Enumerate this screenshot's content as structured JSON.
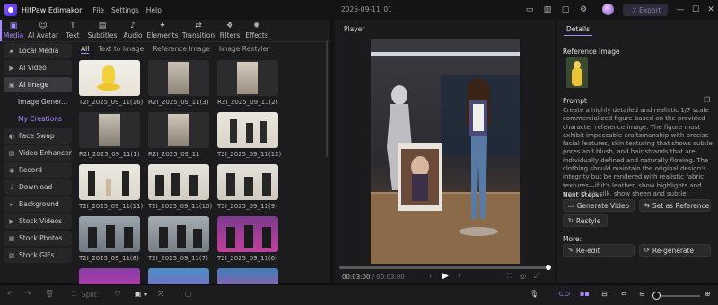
{
  "app": {
    "name": "HitPaw Edimakor",
    "menu": [
      "File",
      "Settings",
      "Help"
    ],
    "document_title": "2025-09-11_01",
    "export_label": "Export"
  },
  "toolbar": {
    "tools": [
      {
        "label": "Media",
        "icon": "media-icon",
        "active": true
      },
      {
        "label": "AI Avatar",
        "icon": "ai-avatar-icon",
        "active": false
      },
      {
        "label": "Text",
        "icon": "text-icon",
        "active": false
      },
      {
        "label": "Subtitles",
        "icon": "subtitles-icon",
        "active": false
      },
      {
        "label": "Audio",
        "icon": "audio-icon",
        "active": false
      },
      {
        "label": "Elements",
        "icon": "elements-icon",
        "active": false
      },
      {
        "label": "Transition",
        "icon": "transition-icon",
        "active": false
      },
      {
        "label": "Filters",
        "icon": "filters-icon",
        "active": false
      },
      {
        "label": "Effects",
        "icon": "effects-icon",
        "active": false
      }
    ]
  },
  "sidebar": {
    "items": [
      {
        "label": "Local Media",
        "icon": "folder-icon"
      },
      {
        "label": "AI Video",
        "icon": "ai-video-icon"
      },
      {
        "label": "AI Image",
        "icon": "ai-image-icon",
        "active": true
      },
      {
        "label": "Image Gener...",
        "sub": true
      },
      {
        "label": "My Creations",
        "sub": true,
        "selected": true
      },
      {
        "label": "Face Swap",
        "icon": "face-swap-icon"
      },
      {
        "label": "Video Enhancer",
        "icon": "enhancer-icon"
      },
      {
        "label": "Record",
        "icon": "record-icon"
      },
      {
        "label": "Download",
        "icon": "download-icon"
      },
      {
        "label": "Background",
        "icon": "background-icon"
      },
      {
        "label": "Stock Videos",
        "icon": "stock-videos-icon"
      },
      {
        "label": "Stock Photos",
        "icon": "stock-photos-icon"
      },
      {
        "label": "Stock GIFs",
        "icon": "stock-gifs-icon"
      }
    ]
  },
  "media": {
    "tabs": [
      "All",
      "Text to Image",
      "Reference Image",
      "Image Restyler"
    ],
    "active_tab": "All",
    "items": [
      {
        "caption": "T2I_2025_09_11(16)"
      },
      {
        "caption": "R2I_2025_09_11(3)"
      },
      {
        "caption": "R2I_2025_09_11(2)"
      },
      {
        "caption": "R2I_2025_09_11(1)"
      },
      {
        "caption": "R2I_2025_09_11"
      },
      {
        "caption": "T2I_2025_09_11(12)"
      },
      {
        "caption": "T2I_2025_09_11(11)"
      },
      {
        "caption": "T2I_2025_09_11(10)"
      },
      {
        "caption": "T2I_2025_09_11(9)"
      },
      {
        "caption": "T2I_2025_09_11(8)"
      },
      {
        "caption": "T2I_2025_09_11(7)"
      },
      {
        "caption": "T2I_2025_09_11(6)"
      },
      {
        "caption": ""
      },
      {
        "caption": ""
      },
      {
        "caption": ""
      }
    ]
  },
  "player": {
    "title": "Player",
    "current_time": "00:03:00",
    "duration": "/ 00:03:00",
    "progress": 1.0
  },
  "details": {
    "tab": "Details",
    "reference_heading": "Reference Image",
    "prompt_heading": "Prompt",
    "prompt_text": "Create a highly detailed and realistic 1/7 scale commercialized figure based on the provided character reference image. The figure must exhibit impeccable craftsmanship with precise facial features, skin texturing that shows subtle pores and blush, and hair strands that are individually defined and naturally flowing. The clothing should maintain the original design's integrity but be rendered with realistic fabric textures—if it's leather, show highlights and wear; if it's silk, show sheen and subtle wrinkle...",
    "next_steps_heading": "Next Steps:",
    "next_steps": [
      {
        "label": "Generate Video",
        "icon": "video-icon"
      },
      {
        "label": "Set as Reference",
        "icon": "reference-icon"
      },
      {
        "label": "Restyle",
        "icon": "restyle-icon"
      }
    ],
    "more_heading": "More:",
    "more": [
      {
        "label": "Re-edit",
        "icon": "edit-icon"
      },
      {
        "label": "Re-generate",
        "icon": "regenerate-icon"
      }
    ]
  },
  "bottom": {
    "split_label": "Split"
  }
}
